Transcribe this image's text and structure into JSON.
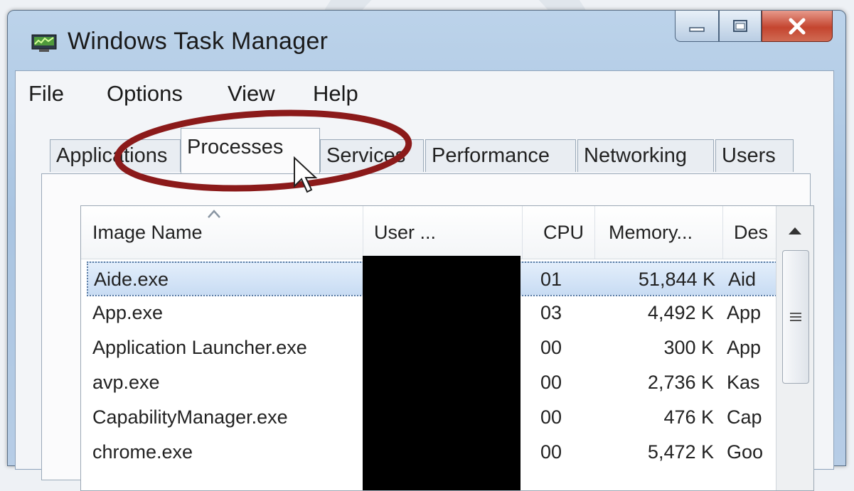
{
  "window": {
    "title": "Windows Task Manager"
  },
  "menu": [
    "File",
    "Options",
    "View",
    "Help"
  ],
  "tabs": [
    {
      "label": "Applications",
      "active": false
    },
    {
      "label": "Processes",
      "active": true
    },
    {
      "label": "Services",
      "active": false
    },
    {
      "label": "Performance",
      "active": false
    },
    {
      "label": "Networking",
      "active": false
    },
    {
      "label": "Users",
      "active": false
    }
  ],
  "columns": {
    "image_name": "Image Name",
    "user": "User ...",
    "cpu": "CPU",
    "memory": "Memory...",
    "description": "Des"
  },
  "rows": [
    {
      "name": "Aide.exe",
      "cpu": "01",
      "memory": "51,844 K",
      "desc": "Aid",
      "selected": true
    },
    {
      "name": "App.exe",
      "cpu": "03",
      "memory": "4,492 K",
      "desc": "App",
      "selected": false
    },
    {
      "name": "Application Launcher.exe",
      "cpu": "00",
      "memory": "300 K",
      "desc": "App",
      "selected": false
    },
    {
      "name": "avp.exe",
      "cpu": "00",
      "memory": "2,736 K",
      "desc": "Kas",
      "selected": false
    },
    {
      "name": "CapabilityManager.exe",
      "cpu": "00",
      "memory": "476 K",
      "desc": "Cap",
      "selected": false
    },
    {
      "name": "chrome.exe",
      "cpu": "00",
      "memory": "5,472 K",
      "desc": "Goo",
      "selected": false
    }
  ],
  "icons": {
    "app": "task-manager-icon",
    "minimize": "minimize-icon",
    "maximize": "maximize-icon",
    "close": "close-icon",
    "sort": "sort-ascending-icon",
    "scroll_up": "scroll-up-arrow-icon",
    "cursor": "mouse-cursor-icon"
  },
  "colors": {
    "highlight_ellipse": "#8b1a1a",
    "selection": "#c8dcf3",
    "close_button": "#c4452f"
  }
}
